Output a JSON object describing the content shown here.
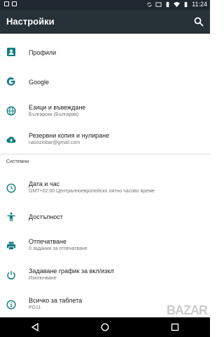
{
  "status": {
    "time": "11:24"
  },
  "appbar": {
    "title": "Настройки",
    "search_icon": "search-icon"
  },
  "colors": {
    "appbar": "#263238",
    "statusbar": "#1f2730",
    "accent": "#0f7c80"
  },
  "items_top": [
    {
      "id": "profiles",
      "icon": "person-card-icon",
      "title": "Профили"
    },
    {
      "id": "google",
      "icon": "google-icon",
      "title": "Google"
    },
    {
      "id": "languages",
      "icon": "globe-icon",
      "title": "Езици и въвеждане",
      "subtitle": "Български (България)"
    },
    {
      "id": "backup",
      "icon": "cloud-upload-icon",
      "title": "Резервни копия и нулиране",
      "subtitle": "nasozlobar@gmail.com"
    }
  ],
  "section": {
    "title": "Системни"
  },
  "items_system": [
    {
      "id": "datetime",
      "icon": "clock-icon",
      "title": "Дата и час",
      "subtitle": "GMT+02:00 Централноевропейско лятно часово време"
    },
    {
      "id": "accessibility",
      "icon": "accessibility-icon",
      "title": "Достъпност"
    },
    {
      "id": "printing",
      "icon": "printer-icon",
      "title": "Отпечатване",
      "subtitle": "0 задания за отпечатване"
    },
    {
      "id": "schedule",
      "icon": "power-schedule-icon",
      "title": "Задаване график за вкл/изкл",
      "subtitle": "Изключване"
    },
    {
      "id": "about",
      "icon": "info-icon",
      "title": "Всичко за таблета",
      "subtitle": "PG11"
    }
  ],
  "watermark": "BAZAR"
}
